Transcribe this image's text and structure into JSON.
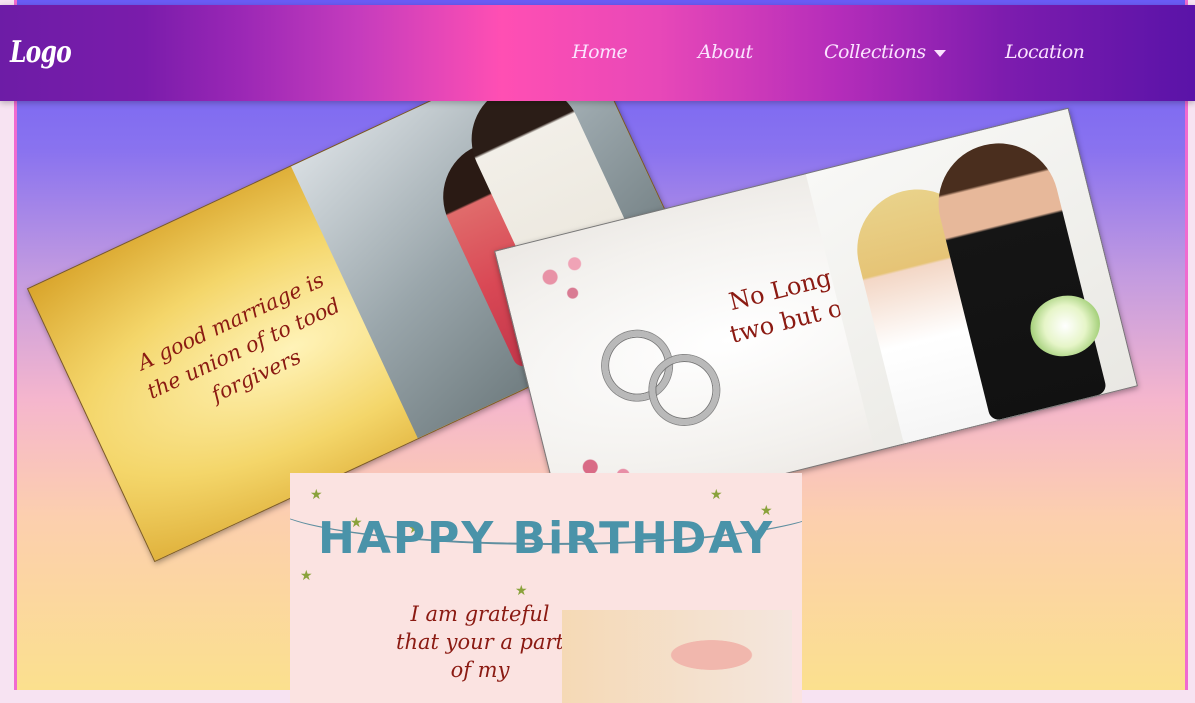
{
  "navbar": {
    "logo": "Logo",
    "links": [
      "Home",
      "About",
      "Collections",
      "Location"
    ]
  },
  "cards": {
    "gold": {
      "text": "A good marriage is the union of to tood forgivers"
    },
    "white": {
      "text": "No Longer two but one"
    },
    "birthday": {
      "title": "HAPPY BiRTHDAY",
      "text": "I am grateful that your a part of my"
    }
  },
  "colors": {
    "nav_start": "#6d1ca6",
    "nav_mid": "#ff4fb3",
    "nav_end": "#5a13a8",
    "text_maroon": "#8b1a12"
  },
  "icons": [
    "caret-down-icon"
  ]
}
